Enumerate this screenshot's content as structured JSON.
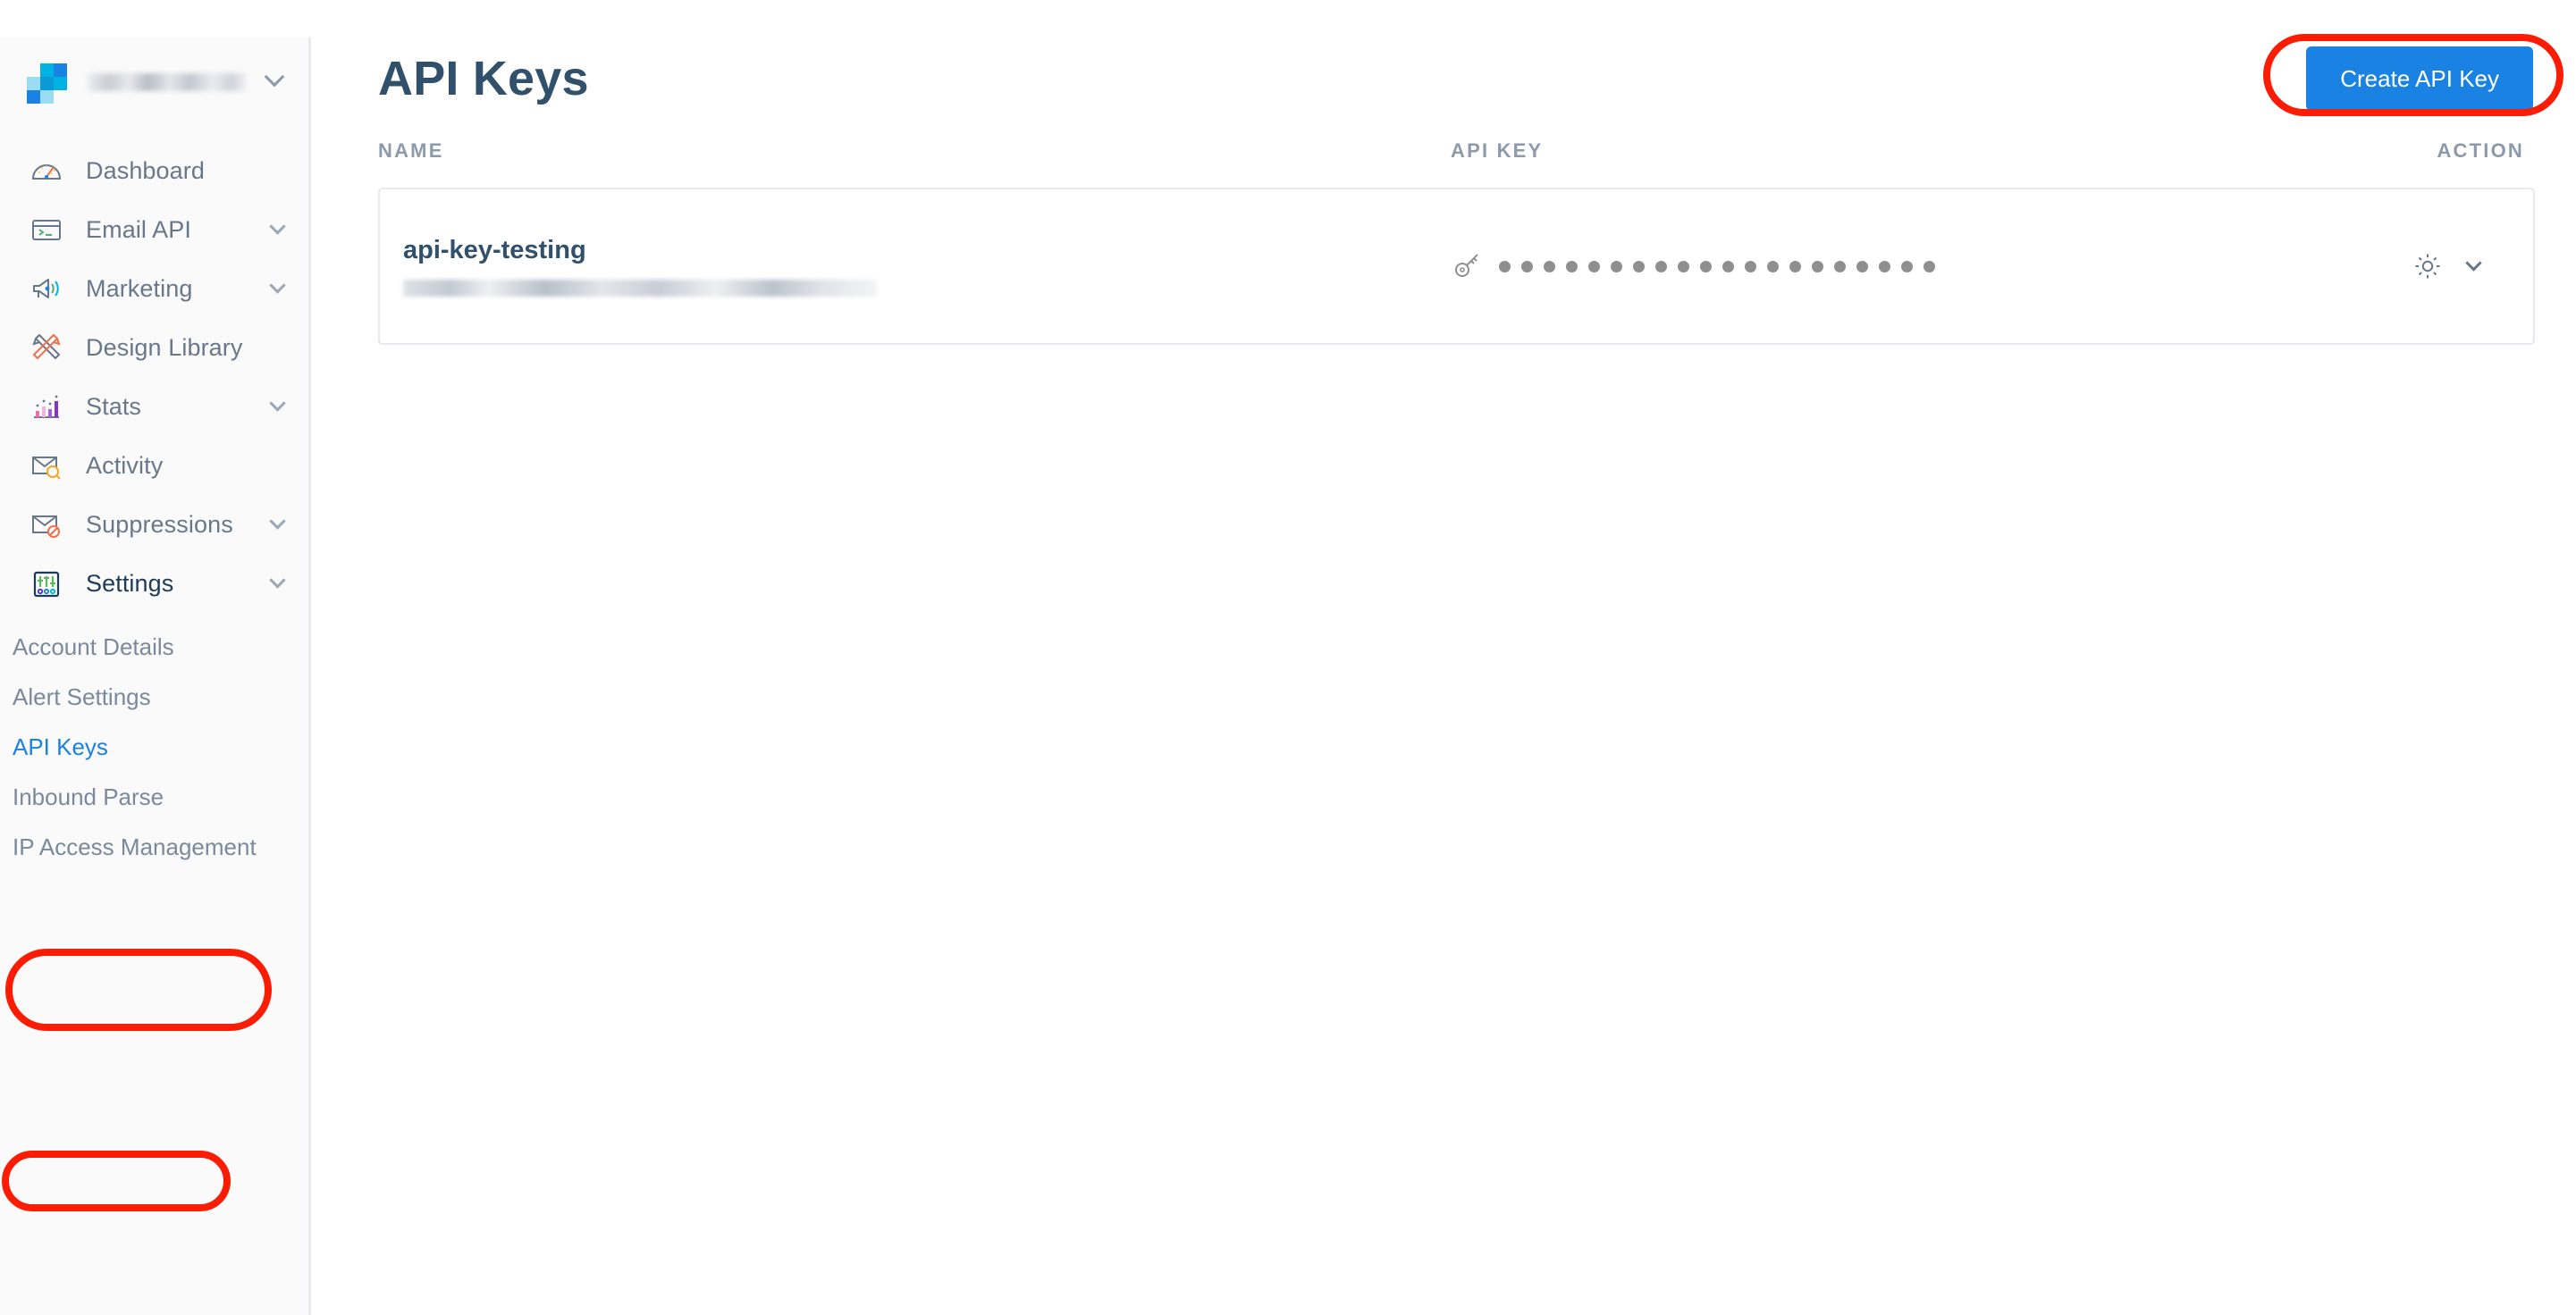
{
  "account": {
    "name_redacted": true,
    "logo_name": "sendgrid-logo",
    "chevron": "chevron-down-icon"
  },
  "sidebar": {
    "items": [
      {
        "label": "Dashboard",
        "icon": "speedometer-icon",
        "expandable": false
      },
      {
        "label": "Email API",
        "icon": "terminal-icon",
        "expandable": true
      },
      {
        "label": "Marketing",
        "icon": "megaphone-icon",
        "expandable": true
      },
      {
        "label": "Design Library",
        "icon": "pencil-ruler-icon",
        "expandable": false
      },
      {
        "label": "Stats",
        "icon": "bar-chart-icon",
        "expandable": true
      },
      {
        "label": "Activity",
        "icon": "envelope-search-icon",
        "expandable": false
      },
      {
        "label": "Suppressions",
        "icon": "envelope-block-icon",
        "expandable": true
      },
      {
        "label": "Settings",
        "icon": "sliders-icon",
        "expandable": true
      }
    ],
    "settings_submenu": [
      {
        "label": "Account Details",
        "active": false
      },
      {
        "label": "Alert Settings",
        "active": false
      },
      {
        "label": "API Keys",
        "active": true
      },
      {
        "label": "Inbound Parse",
        "active": false
      },
      {
        "label": "IP Access Management",
        "active": false
      }
    ]
  },
  "header": {
    "title": "API Keys",
    "create_button": "Create API Key"
  },
  "table": {
    "columns": [
      "NAME",
      "API KEY",
      "ACTION"
    ],
    "rows": [
      {
        "name": "api-key-testing",
        "subtitle_redacted": true,
        "api_key_icon": "key-icon",
        "api_key_masked_dots": 20,
        "actions": [
          "gear-icon",
          "chevron-down-icon"
        ]
      }
    ]
  },
  "annotations": {
    "color": "#fb1c04",
    "markers": [
      "settings-nav-item",
      "api-keys-sub-item",
      "create-api-key-button"
    ]
  },
  "colors": {
    "accent_blue": "#1a82e2",
    "title_navy": "#31506b",
    "sidebar_bg": "#fafafa",
    "muted_text": "#69778b",
    "annotation_red": "#fb1c04"
  }
}
